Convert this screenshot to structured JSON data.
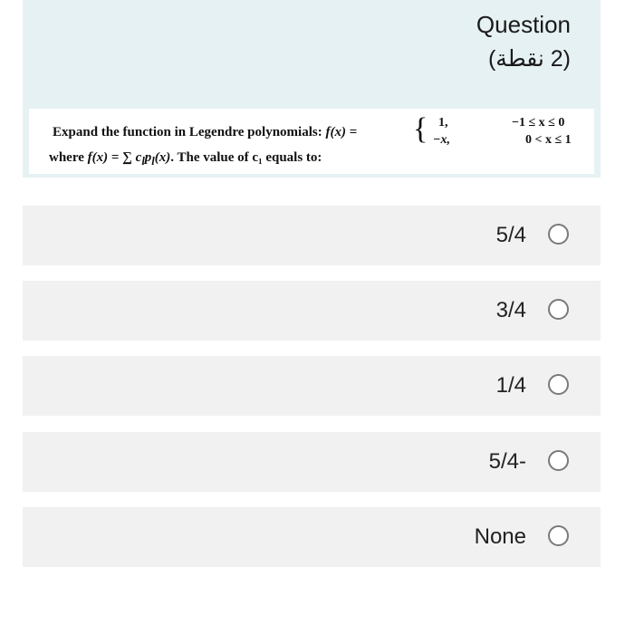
{
  "question": {
    "title": "Question",
    "points": "(2 نقطة)",
    "text_part1": "Expand the function in Legendre polynomials: ",
    "func_lhs": "f(x)",
    "equals": " = ",
    "brace": "{",
    "case1_value": "1,",
    "case1_condition": "−1 ≤ x ≤ 0",
    "case2_value": "−x,",
    "case2_condition": "0 < x ≤ 1",
    "where_text": "where ",
    "where_func": "f(x)",
    "where_eq": " = ∑ ",
    "where_sum": "c",
    "where_sub1": "l",
    "where_p": "p",
    "where_sub2": "l",
    "where_arg": "(x)",
    "where_rest": ". The value of c₁ equals to:"
  },
  "options": [
    {
      "label": "5/4"
    },
    {
      "label": "3/4"
    },
    {
      "label": "1/4"
    },
    {
      "label": "5/4-"
    },
    {
      "label": "None"
    }
  ]
}
